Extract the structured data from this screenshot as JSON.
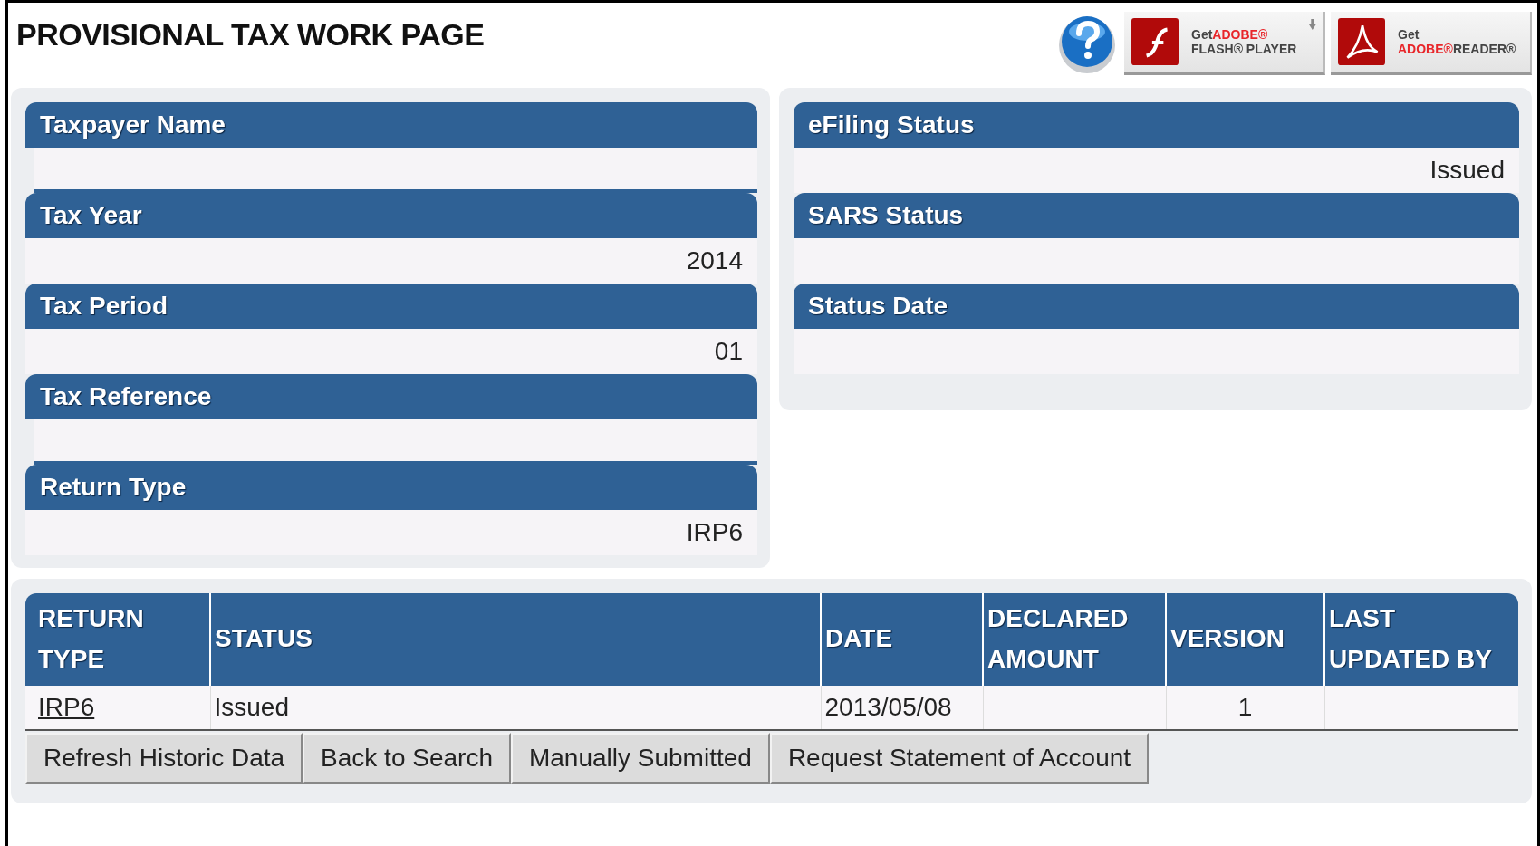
{
  "title": "PROVISIONAL TAX WORK PAGE",
  "downloads": [
    {
      "kind": "flash",
      "get": "Get",
      "brand": "ADOBE®",
      "product": "FLASH® PLAYER"
    },
    {
      "kind": "reader",
      "get": "Get",
      "brand": "ADOBE®",
      "product": "READER®"
    }
  ],
  "left_fields": [
    {
      "label": "Taxpayer Name",
      "underlined": true
    },
    {
      "label": "Tax Year",
      "value": "2014",
      "underlined": false
    },
    {
      "label": "Tax Period",
      "value": "01",
      "underlined": false
    },
    {
      "label": "Tax Reference",
      "underlined": true
    },
    {
      "label": "Return Type",
      "value": "IRP6",
      "underlined": false
    }
  ],
  "right_fields": [
    {
      "label": "eFiling Status",
      "value": "Issued"
    },
    {
      "label": "SARS Status"
    },
    {
      "label": "Status Date"
    }
  ],
  "table": {
    "columns": [
      "RETURN TYPE",
      "STATUS",
      "DATE",
      "DECLARED AMOUNT",
      "VERSION",
      "LAST UPDATED BY"
    ],
    "rows": [
      {
        "return_type": "IRP6",
        "status": "Issued",
        "date": "2013/05/08",
        "version": "1"
      }
    ]
  },
  "buttons": [
    "Refresh Historic Data",
    "Back to Search",
    "Manually Submitted",
    "Request Statement of Account"
  ]
}
